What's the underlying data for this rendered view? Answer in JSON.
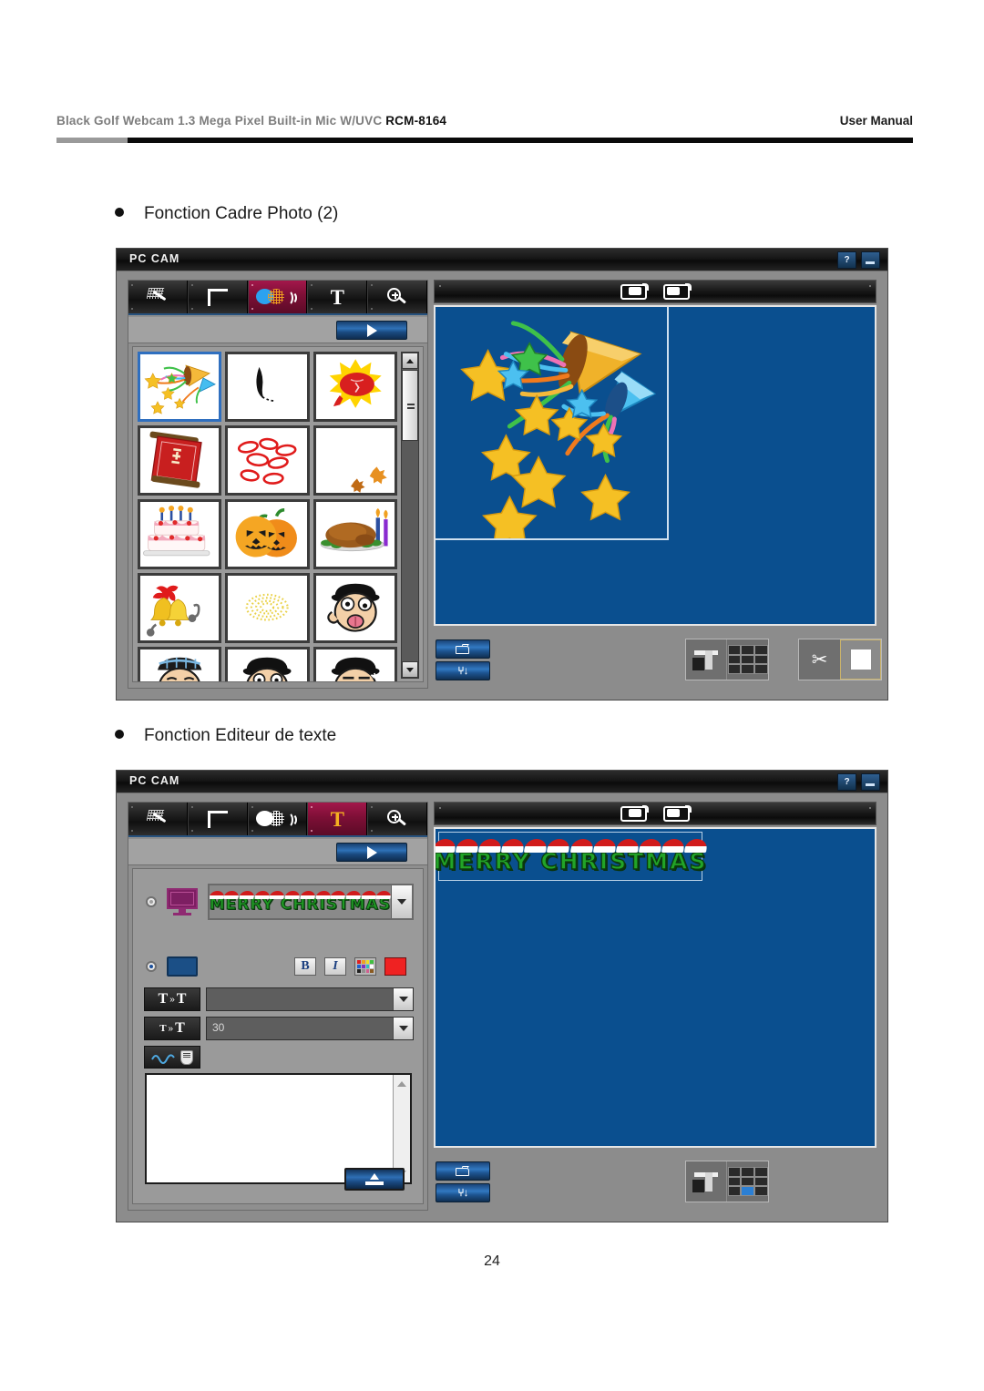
{
  "header": {
    "product_prefix": "Black  Golf  Webcam 1.3 Mega Pixel Built-in Mic W/UVC ",
    "model": "RCM-8164",
    "right_label": "User  Manual"
  },
  "sections": [
    {
      "title": "Fonction Cadre Photo (2)"
    },
    {
      "title": "Fonction Editeur de texte"
    }
  ],
  "page_number": "24",
  "window1": {
    "title": "PC CAM",
    "window_buttons": {
      "help": "?",
      "minimize": ""
    },
    "toolbar": [
      {
        "name": "effects-wand",
        "label": "",
        "active": false
      },
      {
        "name": "frame-crop",
        "label": "",
        "active": false
      },
      {
        "name": "photo-frame",
        "label": "",
        "active": true
      },
      {
        "name": "text-tool",
        "label": "T",
        "active": false
      },
      {
        "name": "zoom-tool",
        "label": "",
        "active": false
      }
    ],
    "play_button_label": "",
    "thumbnails": [
      {
        "name": "party-popper",
        "selected": true
      },
      {
        "name": "black-brush",
        "selected": false
      },
      {
        "name": "red-sun-badge",
        "selected": false
      },
      {
        "name": "red-scroll",
        "selected": false
      },
      {
        "name": "red-lips",
        "selected": false
      },
      {
        "name": "autumn-leaves",
        "selected": false
      },
      {
        "name": "birthday-cake",
        "selected": false
      },
      {
        "name": "halloween-pumpkins",
        "selected": false
      },
      {
        "name": "roast-turkey",
        "selected": false
      },
      {
        "name": "christmas-bells",
        "selected": false
      },
      {
        "name": "gold-wreath",
        "selected": false
      },
      {
        "name": "cartoon-face-tongue",
        "selected": false
      },
      {
        "name": "cartoon-face-tear",
        "selected": false
      },
      {
        "name": "cartoon-face-laugh",
        "selected": false
      },
      {
        "name": "cartoon-face-thinking",
        "selected": false
      }
    ],
    "preview": {
      "toggles": [
        "brightness-toggle",
        "contrast-toggle"
      ],
      "content_name": "party-popper-overlay",
      "background_color": "#0a4f8f"
    },
    "bottom": {
      "open_folder": "",
      "settings": "",
      "layout_single": "",
      "layout_grid": "",
      "scissors": "",
      "capture": ""
    }
  },
  "window2": {
    "title": "PC CAM",
    "window_buttons": {
      "help": "?",
      "minimize": ""
    },
    "toolbar": [
      {
        "name": "effects-wand",
        "label": "",
        "active": false
      },
      {
        "name": "frame-crop",
        "label": "",
        "active": false
      },
      {
        "name": "photo-frame",
        "label": "",
        "active": false
      },
      {
        "name": "text-tool",
        "label": "T",
        "active": true
      },
      {
        "name": "zoom-tool",
        "label": "",
        "active": false
      }
    ],
    "play_button_label": "",
    "editor": {
      "image_mode_selected": false,
      "image_dropdown_value": "MERRY  CHRISTMAS",
      "text_mode_selected": true,
      "format_buttons": {
        "bold": "B",
        "italic": "I",
        "palette": "",
        "color_swatch": "#ef2222"
      },
      "font_family_value": "",
      "font_size_value": "30",
      "effect_button": "",
      "text_content": "",
      "apply_button": ""
    },
    "preview": {
      "toggles": [
        "brightness-toggle",
        "contrast-toggle"
      ],
      "overlay_text": "MERRY  CHRISTMAS",
      "background_color": "#0a4f8f"
    },
    "bottom": {
      "open_folder": "",
      "settings": "",
      "layout_single": "",
      "layout_grid": "",
      "grid_highlight_index": 7
    }
  }
}
